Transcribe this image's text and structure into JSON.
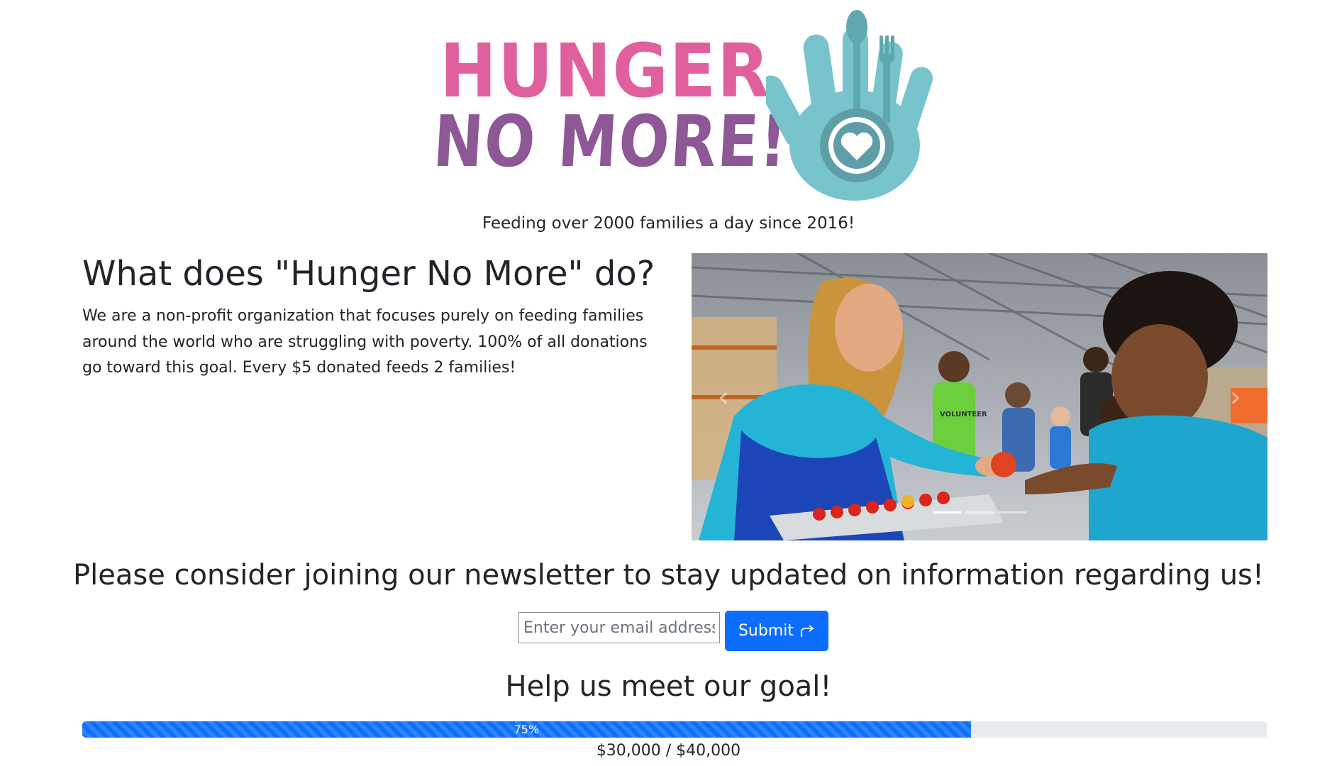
{
  "logo": {
    "line1": "HUNGER",
    "line2": "NO MORE!",
    "colors": {
      "pink": "#e0609e",
      "purple": "#8e5796",
      "teal": "#77c4cc"
    },
    "icon": "hand-with-fork-spoon-heart-icon"
  },
  "tagline": "Feeding over 2000 families a day since 2016!",
  "about": {
    "title": "What does \"Hunger No More\" do?",
    "text": "We are a non-profit organization that focuses purely on feeding families around the world who are struggling with poverty. 100% of all donations go toward this goal. Every $5 donated feeds 2 families!"
  },
  "carousel": {
    "prev_icon": "chevron-left-icon",
    "next_icon": "chevron-right-icon",
    "prev_glyph": "‹",
    "next_glyph": "›",
    "slide_count": 3,
    "active_slide": 1,
    "apron_text": "VOLUNTEER"
  },
  "newsletter": {
    "title": "Please consider joining our newsletter to stay updated on information regarding us!",
    "placeholder": "Enter your email address",
    "submit_label": "Submit",
    "submit_icon": "share-arrow-icon"
  },
  "goal": {
    "title": "Help us meet our goal!",
    "percent": 75,
    "percent_label": "75%",
    "amount_label": "$30,000 / $40,000",
    "bar_color": "#0d6efd"
  }
}
